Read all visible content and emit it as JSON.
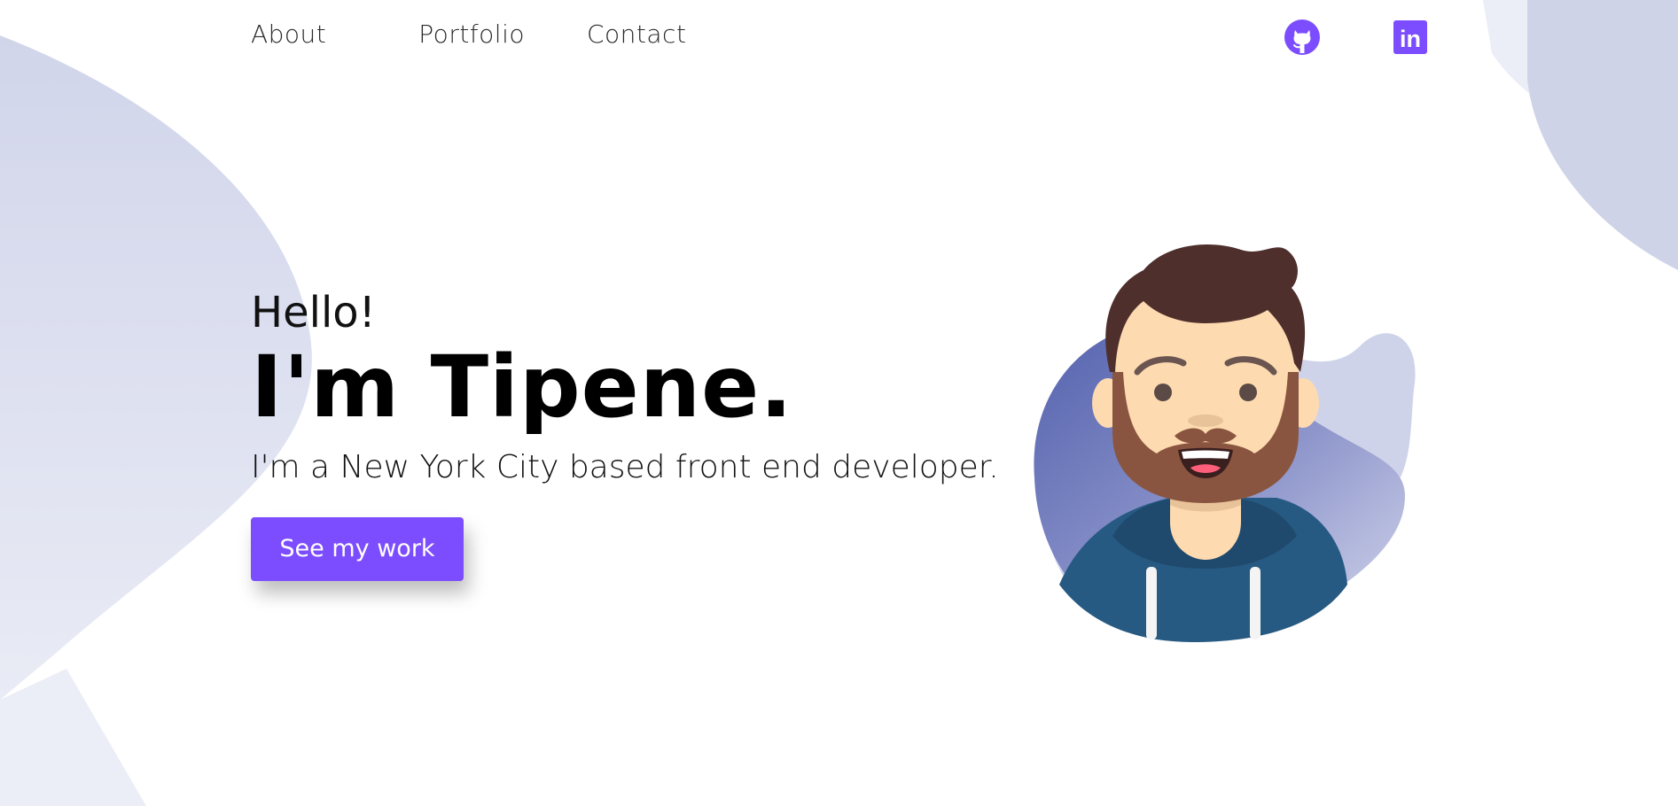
{
  "nav": {
    "about": "About",
    "portfolio": "Portfolio",
    "contact": "Contact"
  },
  "social": {
    "github_icon": "github-icon",
    "linkedin_icon": "linkedin-icon",
    "linkedin_text": "in"
  },
  "hero": {
    "greeting": "Hello!",
    "name": "I'm Tipene.",
    "tagline": "I'm a New York City based front end developer.",
    "cta_label": "See my work"
  },
  "colors": {
    "accent": "#7c4dff",
    "blob": "#d3d6ea",
    "hoodie": "#275a82",
    "hair": "#4e2f2c"
  }
}
